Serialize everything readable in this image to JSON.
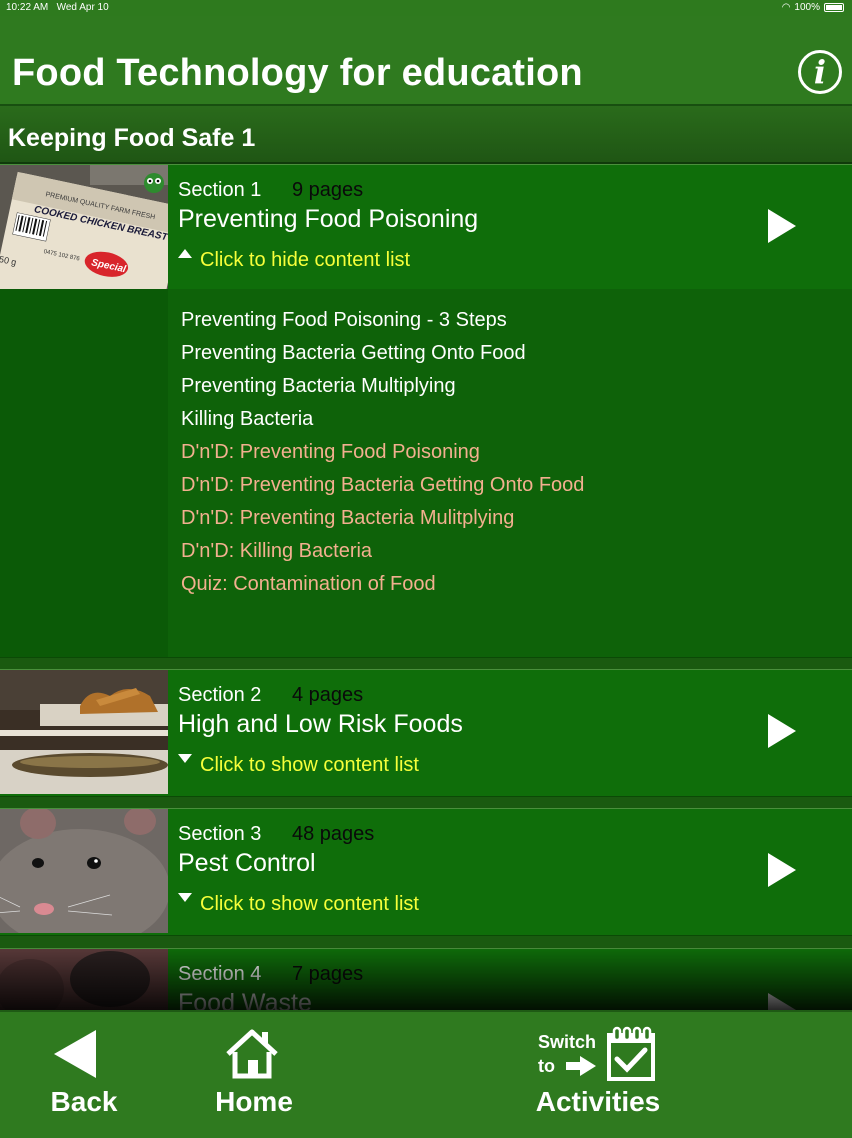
{
  "status": {
    "time": "10:22 AM",
    "date": "Wed Apr 10",
    "battery": "100%"
  },
  "header": {
    "title": "Food Technology for education",
    "info_glyph": "i"
  },
  "subheader": {
    "title": "Keeping Food Safe 1"
  },
  "sections": [
    {
      "label": "Section 1",
      "pages": "9 pages",
      "title": "Preventing Food Poisoning",
      "toggle": "Click to hide content list",
      "expanded": true,
      "thumb_text": {
        "farm": "PREMIUM QUALITY FARM FRESH",
        "product": "COOKED CHICKEN BREAST",
        "badge": "Special",
        "barcode": "0475 102 876",
        "weight": "50 g"
      },
      "content": [
        {
          "text": "Preventing Food Poisoning - 3 Steps",
          "kind": "page"
        },
        {
          "text": "Preventing Bacteria Getting Onto Food",
          "kind": "page"
        },
        {
          "text": "Preventing Bacteria Multiplying",
          "kind": "page"
        },
        {
          "text": "Killing Bacteria",
          "kind": "page"
        },
        {
          "text": "D'n'D: Preventing Food Poisoning",
          "kind": "activity"
        },
        {
          "text": "D'n'D: Preventing Bacteria Getting Onto Food",
          "kind": "activity"
        },
        {
          "text": "D'n'D: Preventing Bacteria Mulitplying",
          "kind": "activity"
        },
        {
          "text": "D'n'D: Killing Bacteria",
          "kind": "activity"
        },
        {
          "text": "Quiz: Contamination of Food",
          "kind": "activity"
        }
      ]
    },
    {
      "label": "Section 2",
      "pages": "4 pages",
      "title": "High and Low Risk Foods",
      "toggle": "Click to show content list",
      "expanded": false
    },
    {
      "label": "Section 3",
      "pages": "48 pages",
      "title": "Pest Control",
      "toggle": "Click to show content list",
      "expanded": false
    },
    {
      "label": "Section 4",
      "pages": "7 pages",
      "title": "Food Waste",
      "toggle": "",
      "expanded": false
    }
  ],
  "toolbar": {
    "back": "Back",
    "home": "Home",
    "switch_line1": "Switch",
    "switch_line2": "to",
    "activities": "Activities"
  },
  "colors": {
    "green": "#2f7a1f",
    "section_green": "#0f6e0a",
    "link_yellow": "#f6ff3a",
    "activity_peach": "#f2b08f"
  }
}
